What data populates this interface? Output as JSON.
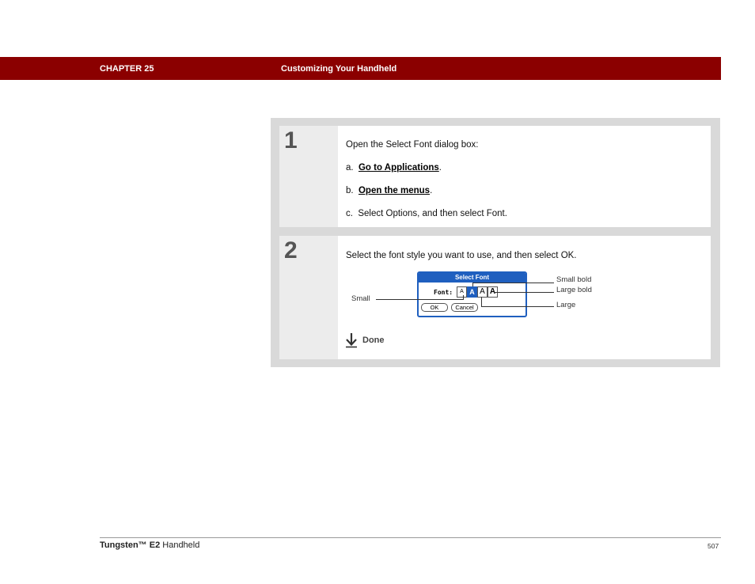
{
  "header": {
    "chapter": "CHAPTER 25",
    "title": "Customizing Your Handheld",
    "bar_color": "#8b0000"
  },
  "step1": {
    "number": "1",
    "intro": "Open the Select Font dialog box:",
    "items": [
      {
        "marker": "a.",
        "link": "Go to Applications",
        "suffix": "."
      },
      {
        "marker": "b.",
        "link": "Open the menus",
        "suffix": "."
      },
      {
        "marker": "c.",
        "text": "Select Options, and then select Font."
      }
    ]
  },
  "step2": {
    "number": "2",
    "intro": "Select the font style you want to use, and then select OK.",
    "dialog": {
      "title": "Select Font",
      "font_label": "Font:",
      "font_buttons": [
        "A",
        "A",
        "A",
        "A"
      ],
      "selected_index": 1,
      "ok": "OK",
      "cancel": "Cancel"
    },
    "callouts": {
      "small": "Small",
      "small_bold": "Small bold",
      "large_bold": "Large bold",
      "large": "Large"
    },
    "done": "Done",
    "accent_color": "#1f5fbf"
  },
  "footer": {
    "product_prefix": "Tungsten™ E2",
    "product_suffix": " Handheld",
    "page": "507"
  }
}
